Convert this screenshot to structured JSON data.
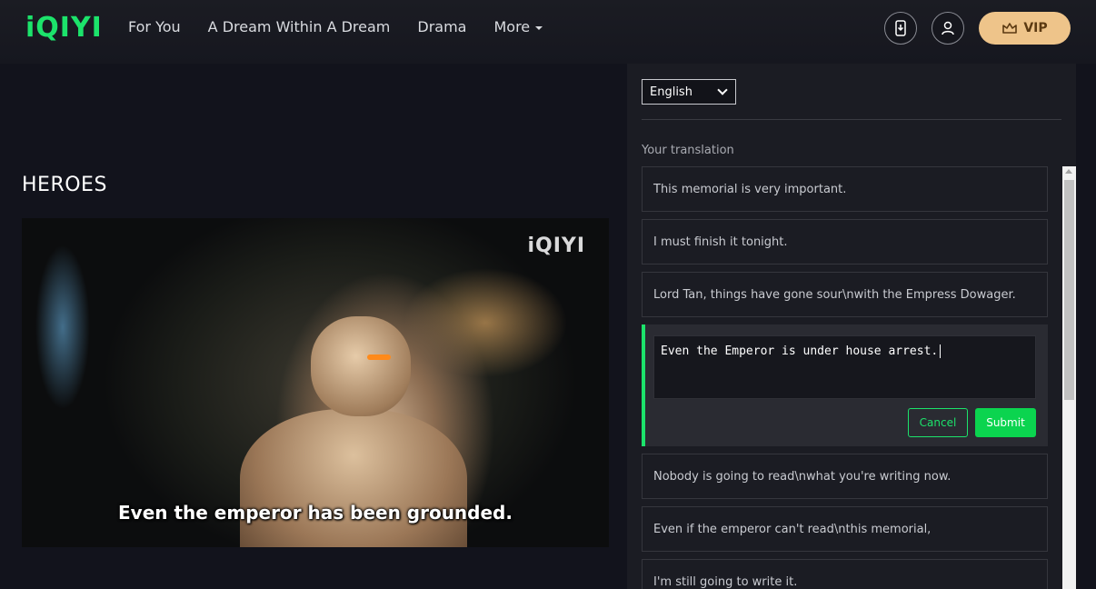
{
  "header": {
    "logo": "iQIYI",
    "nav": [
      "For You",
      "A Dream Within A Dream",
      "Drama",
      "More"
    ],
    "vip_label": "VIP",
    "colors": {
      "brand": "#1ce36b",
      "vip_bg": "#eec48a"
    }
  },
  "show": {
    "title": "HEROES",
    "watermark": "iQIYI",
    "subtitle": "Even the emperor has been grounded."
  },
  "panel": {
    "language": "English",
    "section_label": "Your translation",
    "items_before": [
      "This memorial is very important.",
      "I must finish it tonight.",
      "Lord Tan, things have gone sour\\nwith the Empress Dowager."
    ],
    "editing": {
      "value": "Even the Emperor is under house arrest.",
      "cancel_label": "Cancel",
      "submit_label": "Submit"
    },
    "items_after": [
      "Nobody is going to read\\nwhat you're writing now.",
      "Even if the emperor can't read\\nthis memorial,",
      "I'm still going to write it."
    ]
  }
}
